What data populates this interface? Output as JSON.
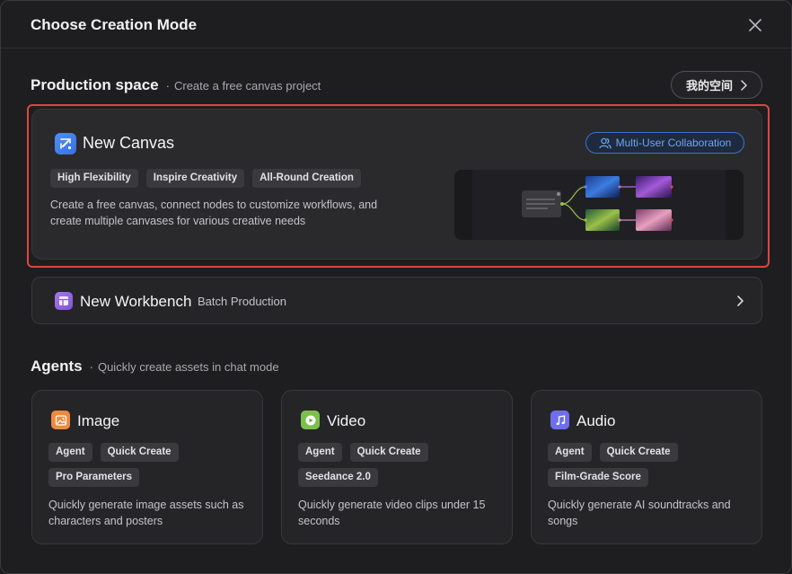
{
  "dialog": {
    "title": "Choose Creation Mode"
  },
  "production": {
    "title": "Production space",
    "subtitle": "Create a free canvas project",
    "my_space_label": "我的空间"
  },
  "canvas_card": {
    "title": "New Canvas",
    "collab_label": "Multi-User Collaboration",
    "tags": [
      "High Flexibility",
      "Inspire Creativity",
      "All-Round Creation"
    ],
    "description_line1": "Create a free canvas, connect nodes to customize workflows, and",
    "description_line2": "create multiple canvases for various creative needs"
  },
  "workbench_card": {
    "title": "New Workbench",
    "subtitle": "Batch Production"
  },
  "agents": {
    "title": "Agents",
    "subtitle": "Quickly create assets in chat mode",
    "cards": [
      {
        "title": "Image",
        "icon": "image-icon",
        "tags": [
          "Agent",
          "Quick Create",
          "Pro Parameters"
        ],
        "description_line1": "Quickly generate image assets such as",
        "description_line2": "characters and posters"
      },
      {
        "title": "Video",
        "icon": "video-play-icon",
        "tags": [
          "Agent",
          "Quick Create",
          "Seedance 2.0"
        ],
        "description_line1": "Quickly generate video clips under 15",
        "description_line2": "seconds"
      },
      {
        "title": "Audio",
        "icon": "music-note-icon",
        "tags": [
          "Agent",
          "Quick Create",
          "Film-Grade Score"
        ],
        "description_line1": "Quickly generate AI soundtracks and",
        "description_line2": "songs"
      }
    ]
  },
  "colors": {
    "highlight": "#e0443f",
    "canvas_icon": "#4f8ff7",
    "workbench_icon": "#a678e8",
    "image_icon": "#f0883e",
    "video_icon": "#7cc04b",
    "audio_icon": "#6f6ef0",
    "collab_badge": "#6ea4f5"
  }
}
